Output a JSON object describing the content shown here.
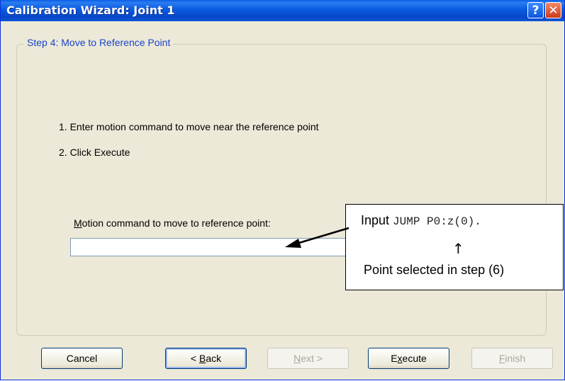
{
  "window": {
    "title": "Calibration Wizard: Joint 1",
    "help_glyph": "?",
    "close_glyph": "✕"
  },
  "step": {
    "group_label": "Step 4: Move to Reference Point",
    "instruction_1": "1. Enter motion command to move near the reference point",
    "instruction_2": "2. Click Execute",
    "field_label_accel": "M",
    "field_label_rest": "otion command to move to reference point:",
    "input_value": ""
  },
  "callout": {
    "prefix": "Input ",
    "code": "JUMP P0:z(0).",
    "up_arrow": "↑",
    "note": "Point selected in step (6)"
  },
  "buttons": {
    "cancel": "Cancel",
    "back_prefix": "< ",
    "back_accel": "B",
    "back_rest": "ack",
    "next_accel": "N",
    "next_rest": "ext >",
    "execute_prefix": "E",
    "execute_accel": "x",
    "execute_rest": "ecute",
    "finish_accel": "F",
    "finish_rest": "inish"
  },
  "icons": {
    "help": "help-icon",
    "close": "close-icon",
    "callout_pointer": "arrow-pointer-icon"
  }
}
